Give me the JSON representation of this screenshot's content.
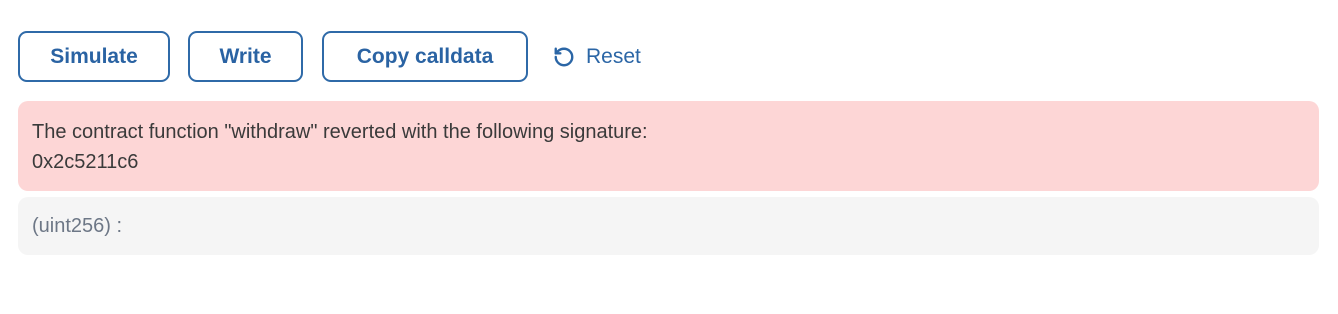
{
  "toolbar": {
    "simulate_label": "Simulate",
    "write_label": "Write",
    "copy_label": "Copy calldata",
    "reset_label": "Reset",
    "reset_icon": "rotate-ccw-icon"
  },
  "error": {
    "message": "The contract function \"withdraw\" reverted with the following signature:",
    "signature": "0x2c5211c6"
  },
  "result": {
    "label": "(uint256) :"
  },
  "colors": {
    "accent": "#2a63a3",
    "error_background": "#fdd6d6",
    "result_background": "#f5f5f5"
  }
}
